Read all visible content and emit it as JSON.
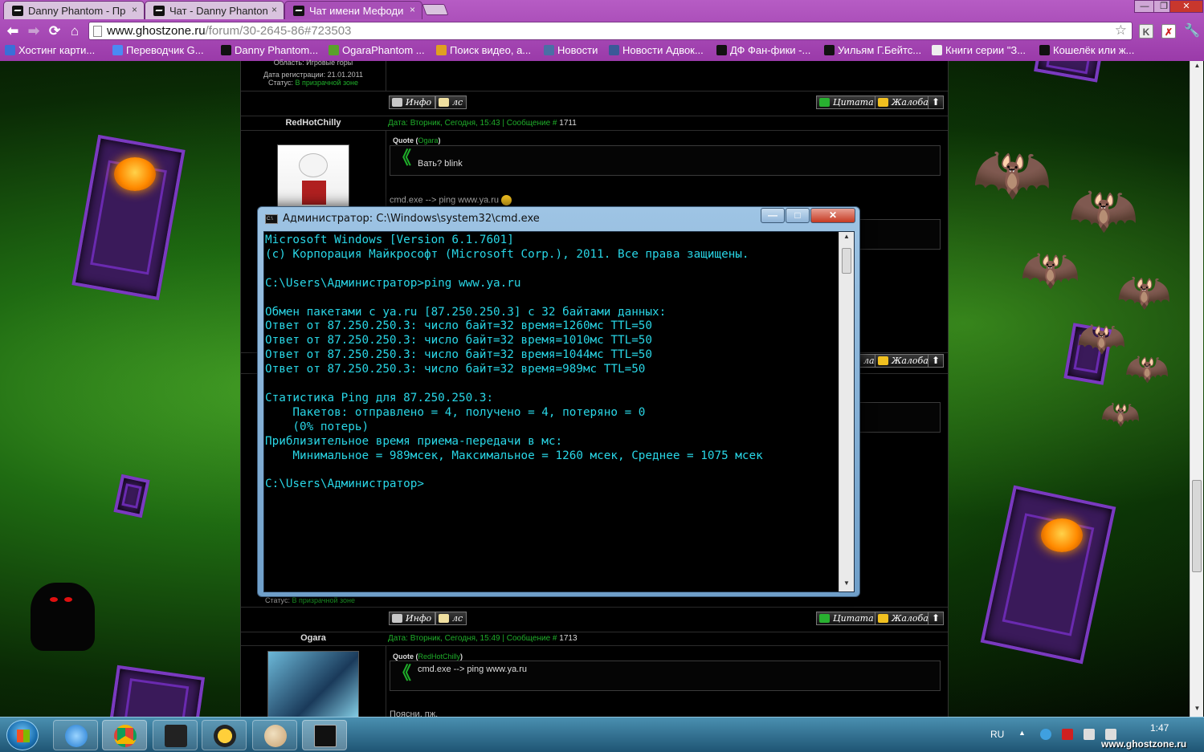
{
  "browser": {
    "tabs": [
      {
        "title": "Danny Phantom - Пр",
        "active": false
      },
      {
        "title": "Чат - Danny Phanton",
        "active": false
      },
      {
        "title": "Чат имени Мефоди",
        "active": true
      }
    ],
    "tab_close": "×",
    "url_host": "www.ghostzone.ru",
    "url_path": "/forum/30-2645-86#723503",
    "bookmarks": [
      {
        "label": "Хостинг карти...",
        "icon_color": "#3a6fd8"
      },
      {
        "label": "Переводчик G...",
        "icon_color": "#4a8af4"
      },
      {
        "label": "Danny Phantom...",
        "icon_color": "#111111"
      },
      {
        "label": "OgaraPhantom ...",
        "icon_color": "#5aa02c"
      },
      {
        "label": "Поиск видео, а...",
        "icon_color": "#e0a020"
      },
      {
        "label": "Новости",
        "icon_color": "#4a6fa5"
      },
      {
        "label": "Новости Адвок...",
        "icon_color": "#3b5998"
      },
      {
        "label": "ДФ Фан-фики -...",
        "icon_color": "#111111"
      },
      {
        "label": "Уильям Г.Бейтс...",
        "icon_color": "#111111"
      },
      {
        "label": "Книги серии \"З...",
        "icon_color": "#eeeeee"
      },
      {
        "label": "Кошелёк или ж...",
        "icon_color": "#111111"
      }
    ],
    "colors": {
      "chrome": "#a84fb7",
      "accent_green": "#1fae2a"
    }
  },
  "forum": {
    "prev_user": {
      "area": "Область: Игровые горы",
      "reg_date": "Дата регистрации: 21.01.2011",
      "status_label": "Статус:",
      "status_value": "В призрачной зоне"
    },
    "buttons": {
      "info": "Инфо",
      "pm": "лс",
      "quote": "Цитата",
      "complain": "Жалоба",
      "complain_partial": "ла",
      "up": "⬆"
    },
    "post1": {
      "author": "RedHotChilly",
      "meta": "Дата: Вторник, Сегодня, 15:43 | Сообщение #",
      "num": "1711",
      "quote_label": "Quote",
      "quote_name": "Ogara",
      "quote_text": "Вать? blink",
      "text": "cmd.exe --> ping www.ya.ru"
    },
    "post2_status_label": "Статус:",
    "post2_status_value": "В призрачной зоне",
    "post3": {
      "author": "Ogara",
      "meta": "Дата: Вторник, Сегодня, 15:49 | Сообщение #",
      "num": "1713",
      "quote_label": "Quote",
      "quote_name": "RedHotChilly",
      "quote_text": "cmd.exe --> ping www.ya.ru",
      "text": "Поясни, пж."
    }
  },
  "cmd": {
    "title": "Администратор: C:\\Windows\\system32\\cmd.exe",
    "icon_text": "C:\\",
    "lines": [
      "Microsoft Windows [Version 6.1.7601]",
      "(c) Корпорация Майкрософт (Microsoft Corp.), 2011. Все права защищены.",
      "",
      "C:\\Users\\Администратор>ping www.ya.ru",
      "",
      "Обмен пакетами с ya.ru [87.250.250.3] с 32 байтами данных:",
      "Ответ от 87.250.250.3: число байт=32 время=1260мс TTL=50",
      "Ответ от 87.250.250.3: число байт=32 время=1010мс TTL=50",
      "Ответ от 87.250.250.3: число байт=32 время=1044мс TTL=50",
      "Ответ от 87.250.250.3: число байт=32 время=989мс TTL=50",
      "",
      "Статистика Ping для 87.250.250.3:",
      "    Пакетов: отправлено = 4, получено = 4, потеряно = 0",
      "    (0% потерь)",
      "Приблизительное время приема-передачи в мс:",
      "    Минимальное = 989мсек, Максимальное = 1260 мсек, Среднее = 1075 мсек",
      "",
      "C:\\Users\\Администратор>"
    ],
    "text_color": "#29d6e6"
  },
  "taskbar": {
    "lang": "RU",
    "time": "1:47",
    "watermark": "www.ghostzone.ru"
  }
}
